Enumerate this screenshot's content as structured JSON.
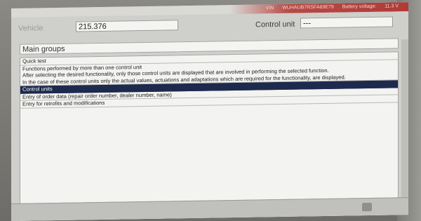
{
  "titlebar": {
    "vin_label": "VIN",
    "vin_value": "WUHAUB7RSFA69E79",
    "battery_label": "Battery voltage:",
    "battery_value": "11.3 V"
  },
  "header": {
    "vehicle_label": "Vehicle",
    "vehicle_value": "215.376",
    "control_unit_label": "Control unit",
    "control_unit_value": "---"
  },
  "main_groups": {
    "title": "Main groups",
    "items": [
      {
        "lines": [
          "Quick test"
        ]
      },
      {
        "lines": [
          "Functions performed by more than one control unit",
          "After selecting the desired functionality, only those control units are displayed that are involved in performing the selected function.",
          "In the case of these control units only the actual values, actuations and adaptations which are required for the functionality, are displayed."
        ]
      },
      {
        "lines": [
          "Control units"
        ],
        "selected": true
      },
      {
        "lines": [
          "Entry of order data (repair order number, dealer number, name)"
        ]
      },
      {
        "lines": [
          "Entry for retrofits and modifications"
        ]
      }
    ]
  },
  "colors": {
    "selected_bg": "#1d2a4d",
    "titlebar_red": "#b03a36"
  }
}
